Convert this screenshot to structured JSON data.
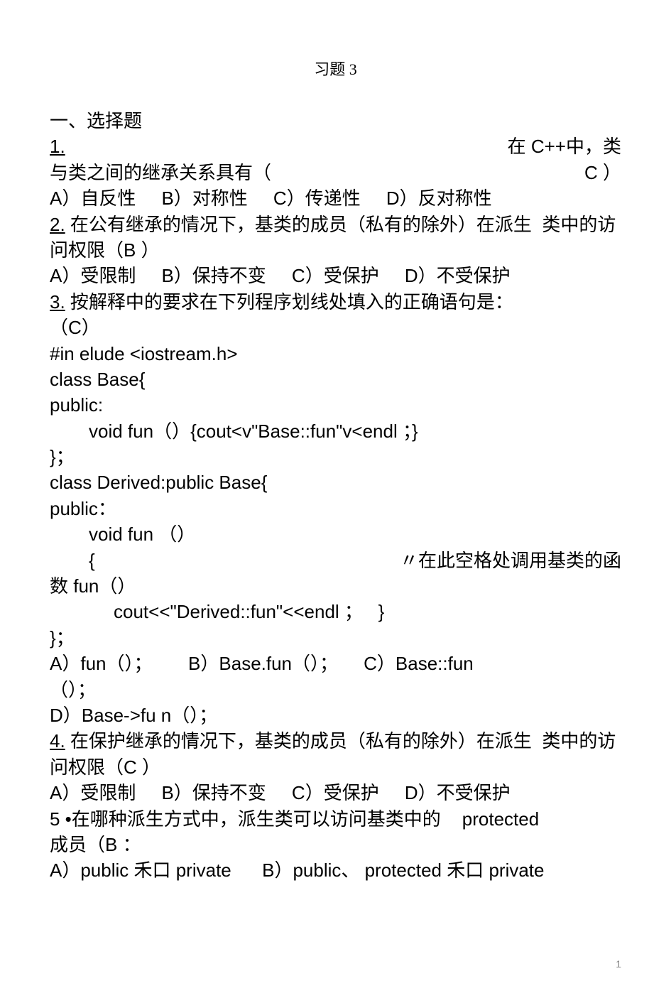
{
  "title": "习题 3",
  "section_heading": "一、选择题",
  "q1": {
    "num": "1.",
    "rightpart": "在 C++中，类",
    "line2_left": "与类之间的继承关系具有（",
    "line2_right": "C ）",
    "options": "A）自反性     B）对称性     C）传递性     D）反对称性"
  },
  "q2": {
    "num": "2.",
    "text": " 在公有继承的情况下，基类的成员（私有的除外）在派生  类中的访问权限（B ）",
    "options": "A）受限制     B）保持不变     C）受保护     D）不受保护"
  },
  "q3": {
    "num": "3.",
    "text": " 按解释中的要求在下列程序划线处填入的正确语句是：",
    "answer_line": "（C）",
    "code1": "#in elude <iostream.h>",
    "code2": "class Base{",
    "code3": "public:",
    "code4": "void fun（）{cout<v\"Base::fun\"v<endl ；}",
    "code5": "}；",
    "code6": "class Derived:public Base{",
    "code7": "public：",
    "code8": "void fun （）",
    "code9_left": "{",
    "code9_right": "〃在此空格处调用基类的函",
    "code10": "数 fun（）",
    "code11": "cout<<\"Derived::fun\"<<endl ；   }",
    "code12": "}；",
    "options_line1": "A）fun（）；       B）Base.fun（）；     C）Base::fun",
    "options_line2": "（）；",
    "options_line3": "D）Base->fu n（）；"
  },
  "q4": {
    "num": "4.",
    "text": " 在保护继承的情况下，基类的成员（私有的除外）在派生  类中的访问权限（C ）",
    "options": "A）受限制     B）保持不变     C）受保护     D）不受保护"
  },
  "q5": {
    "line1_left": "5 •在哪种派生方式中，派生类可以访问基类中的",
    "line1_right": "protected",
    "line2": "成员（B ：",
    "options": "A）public 禾口 private      B）public、 protected 禾口 private"
  },
  "page_number": "1"
}
